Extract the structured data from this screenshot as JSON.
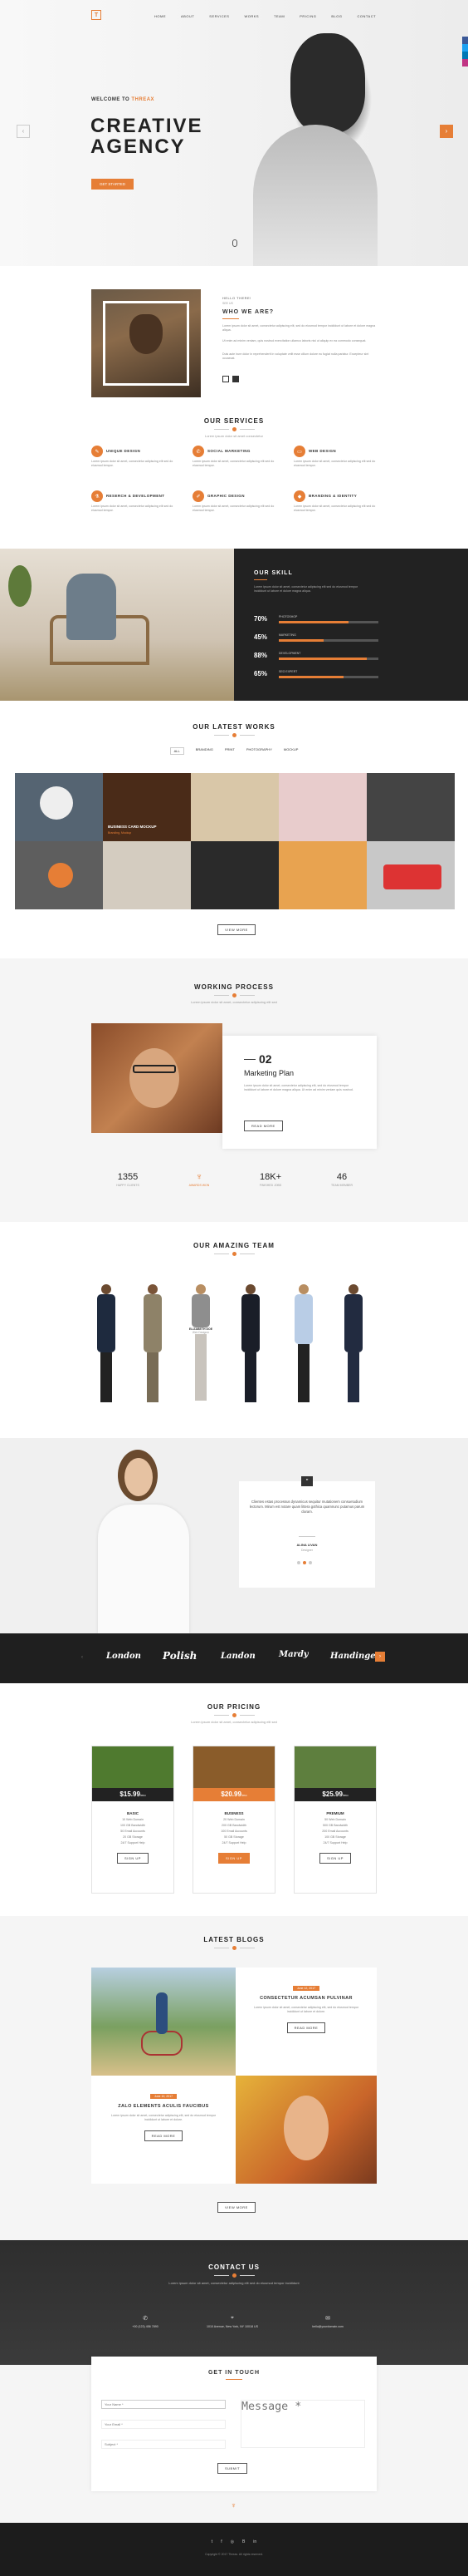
{
  "nav": {
    "items": [
      "HOME",
      "ABOUT",
      "SERVICES",
      "WORKS",
      "TEAM",
      "PRICING",
      "BLOG",
      "CONTACT"
    ]
  },
  "hero": {
    "welcome": "WELCOME TO ",
    "brand": "THREAX",
    "title1": "CREATIVE",
    "title2": "AGENCY",
    "button": "GET STARTED"
  },
  "about": {
    "small": "HELLO THERE!",
    "kicker": "SEE US",
    "heading": "WHO WE ARE?",
    "p1": "Lorem ipsum dolor sit amet, consectetur adipiscing elit, sed do eiusmod tempor incididunt ut labore et dolore magna aliqua.",
    "p2": "Ut enim ad minim veniam, quis nostrud exercitation ullamco laboris nisi ut aliquip ex ea commodo consequat.",
    "p3": "Duis aute irure dolor in reprehenderit in voluptate velit esse cillum dolore eu fugiat nulla pariatur. Excepteur sint occaecat."
  },
  "services": {
    "title": "OUR SERVICES",
    "sub": "Lorem ipsum dolor sit amet consectetur",
    "items": [
      {
        "t": "UNIQUE DESIGN",
        "d": "Lorem ipsum dolor sit amet, consectetur adipiscing elit sed do eiusmod tempor."
      },
      {
        "t": "SOCIAL MARKETING",
        "d": "Lorem ipsum dolor sit amet, consectetur adipiscing elit sed do eiusmod tempor."
      },
      {
        "t": "WEB DESIGN",
        "d": "Lorem ipsum dolor sit amet, consectetur adipiscing elit sed do eiusmod tempor."
      },
      {
        "t": "RESERCH & DEVELOPMENT",
        "d": "Lorem ipsum dolor sit amet, consectetur adipiscing elit sed do eiusmod tempor."
      },
      {
        "t": "GRAPHIC DESIGN",
        "d": "Lorem ipsum dolor sit amet, consectetur adipiscing elit sed do eiusmod tempor."
      },
      {
        "t": "BRANDING & IDENTITY",
        "d": "Lorem ipsum dolor sit amet, consectetur adipiscing elit sed do eiusmod tempor."
      }
    ]
  },
  "skills": {
    "title": "OUR SKILL",
    "desc": "Lorem ipsum dolor sit amet, consectetur adipiscing elit sed do eiusmod tempor incididunt ut labore et dolore magna aliqua.",
    "items": [
      {
        "pct": "70%",
        "label": "PHOTOSHOP",
        "value": 0.7
      },
      {
        "pct": "45%",
        "label": "MARKETING",
        "value": 0.45
      },
      {
        "pct": "88%",
        "label": "DEVELOPMENT",
        "value": 0.88
      },
      {
        "pct": "65%",
        "label": "SEO EXPERT",
        "value": 0.65
      }
    ]
  },
  "works": {
    "title": "OUR LATEST WORKS",
    "filters": [
      "ALL",
      "BRANDING",
      "PRINT",
      "PHOTOGRAPHY",
      "MOCKUP"
    ],
    "overlay_title": "BUSINESS CARD MOCKUP",
    "overlay_sub": "Branding, Mockup",
    "button": "VIEW MORE"
  },
  "process": {
    "title": "WORKING PROCESS",
    "sub": "Lorem ipsum dolor sit amet, consectetur adipiscing elit sed",
    "num": "02",
    "heading": "Marketing Plan",
    "text": "Lorem ipsum dolor sit amet, consectetur adipiscing elit, sed do eiusmod tempor incididunt ut labore et dolore magna aliqua. Ut enim ad minim veniam quis nostrud.",
    "button": "READ MORE"
  },
  "counters": [
    {
      "n": "1355",
      "l": "HAPPY CLIENTS"
    },
    {
      "n": "",
      "l": "AWARDS WON"
    },
    {
      "n": "18K+",
      "l": "FINISHED JOBS"
    },
    {
      "n": "46",
      "l": "TEAM MEMBER"
    }
  ],
  "team": {
    "title": "OUR AMAZING TEAM",
    "sub": "Lorem ipsum dolor sit amet",
    "featured_name": "ELIZABETH DOE",
    "featured_role": "Web Designer"
  },
  "testimonial": {
    "quote": "Clientes estas processus dynamicus sequitur mutationem consuetudium lectorum. Mirum est notare quam littera gothica quamnunc putamus parum claram.",
    "name": "ALINA LIVAN",
    "role": "Designer"
  },
  "clients": [
    "London",
    "Polish",
    "Landon",
    "Mardy",
    "Handinger"
  ],
  "pricing": {
    "title": "OUR PRICING",
    "sub": "Lorem ipsum dolor sit amet, consectetur adipiscing elit sed",
    "plans": [
      {
        "price": "$15.99",
        "per": "/mo",
        "name": "BASIC",
        "features": [
          "10 Web Domain",
          "100 GB Bandwidth",
          "50 Email Accounts",
          "20 GB Storage",
          "24/7 Support Help"
        ],
        "button": "SIGN UP"
      },
      {
        "price": "$20.99",
        "per": "/mo",
        "name": "BUSINESS",
        "features": [
          "20 Web Domain",
          "200 GB Bandwidth",
          "100 Email Accounts",
          "50 GB Storage",
          "24/7 Support Help"
        ],
        "button": "SIGN UP"
      },
      {
        "price": "$25.99",
        "per": "/mo",
        "name": "PREMIUM",
        "features": [
          "50 Web Domain",
          "500 GB Bandwidth",
          "200 Email Accounts",
          "100 GB Storage",
          "24/7 Support Help"
        ],
        "button": "SIGN UP"
      }
    ]
  },
  "blogs": {
    "title": "LATEST BLOGS",
    "posts": [
      {
        "date": "June 12, 2017",
        "title": "CONSECTETUR ACUMSAN  PULVINAR",
        "text": "Lorem ipsum dolor sit amet, consectetur adipiscing elit, sed do eiusmod tempor incididunt ut labore et dolore.",
        "button": "READ MORE"
      },
      {
        "date": "June 10, 2017",
        "title": "ZALO ELEMENTS ACULIS FAUCIBUS",
        "text": "Lorem ipsum dolor sit amet, consectetur adipiscing elit, sed do eiusmod tempor incididunt ut labore et dolore.",
        "button": "READ MORE"
      }
    ],
    "button": "VIEW MORE"
  },
  "contact": {
    "title": "CONTACT US",
    "sub": "Lorem ipsum dolor sit amet, consectetur adipiscing elit sed do eiusmod tempor incididunt",
    "phone": "+00 (123) 456 7890",
    "address": "1010 Avenue, New York, NY 10018 US",
    "email": "hello@yourdomain.com",
    "form_title": "GET IN TOUCH",
    "name_ph": "Your Name *",
    "email_ph": "Your Email *",
    "subject_ph": "Subject *",
    "message_ph": "Message *",
    "submit": "SUBMIT"
  },
  "footer": {
    "copy": "Copyright © 2017 Threax. All rights reserved."
  }
}
